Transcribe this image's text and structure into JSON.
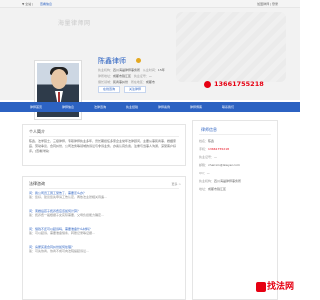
{
  "topbar": {
    "location_prefix": "▼ 全站 |",
    "location_link": "查看信息",
    "right_links": "加盟律师 | 登录"
  },
  "hero": {
    "watermark": "海量律师网"
  },
  "lawyer": {
    "name": "陈鑫律师",
    "info": [
      {
        "label": "执业机构：",
        "value": "四川海晟律师事务所",
        "label2": "从业时间：",
        "value2": "15年"
      },
      {
        "label": "律所地址：",
        "value": "成都市锦江区",
        "label2": "执业证号：",
        "value2": "—"
      },
      {
        "label": "擅长领域：",
        "value": "民商事纠纷",
        "label2": "所在地区：",
        "value2": "成都市"
      }
    ],
    "btn_consult": "在线咨询",
    "btn_follow": "关注律师",
    "phone": "13661755218"
  },
  "nav": [
    "律师首页",
    "律师信息",
    "法律咨询",
    "执业经验",
    "律师案例",
    "律师博客",
    "联系我们"
  ],
  "intro": {
    "title": "个人简介",
    "text": "陈鑫，法学硕士，三级律师，专职律师执业多年，曾长期担任多家企业常年法律顾问，主要从事民商事、婚姻家庭、劳动争议、合同纠纷、公司法务等领域的诉讼与非诉业务，办案认真负责，注重与当事人沟通，深受客户好评。[查看详情]"
  },
  "consult": {
    "title": "法律咨询",
    "more": "更多 >",
    "items": [
      {
        "q": "问：我公司员工因工受伤了，需要怎么办？",
        "a": "答：您好，建议您先申请工伤认定，再依法主张相关待遇..."
      },
      {
        "q": "问：离婚后孩子抚养费应该如何计算？",
        "a": "答：抚养费一般根据子女实际需要、父母负担能力确定..."
      },
      {
        "q": "问：借钱不还可以起诉吗，需要准备什么材料？",
        "a": "答：可以起诉，需要准备借条、转账记录等证据..."
      },
      {
        "q": "问：房屋买卖合同纠纷如何处理？",
        "a": "答：可先协商，协商不成可向法院提起诉讼..."
      }
    ]
  },
  "side": {
    "title": "律师信息",
    "rows": [
      {
        "k": "姓名：",
        "v": "陈鑫"
      },
      {
        "k": "手机：",
        "v": "13661755218"
      },
      {
        "k": "执业证号：",
        "v": "—"
      },
      {
        "k": "邮箱：",
        "v": "chenxin@lawyer.com"
      },
      {
        "k": "QQ：",
        "v": "—"
      },
      {
        "k": "执业机构：",
        "v": "四川海晟律师事务所"
      },
      {
        "k": "地址：",
        "v": "成都市锦江区"
      }
    ]
  },
  "stamp": "找法网"
}
